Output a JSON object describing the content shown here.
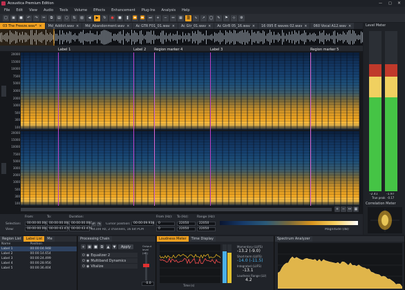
{
  "app": {
    "title": "Acoustica Premium Edition"
  },
  "menu": [
    "File",
    "Edit",
    "View",
    "Audio",
    "Tools",
    "Volume",
    "Effects",
    "Enhancement",
    "Plug-Ins",
    "Analysis",
    "Help"
  ],
  "tabs": [
    {
      "label": "03 The Freeze.wav*",
      "active": true
    },
    {
      "label": "Md_Addict.wav",
      "active": false
    },
    {
      "label": "Md_Abandonment.wav",
      "active": false
    },
    {
      "label": "Ac GTR F01_01.wav",
      "active": false
    },
    {
      "label": "Ac Gtr_01.wav",
      "active": false
    },
    {
      "label": "Ac GtrB 05_16.wav",
      "active": false
    },
    {
      "label": "16 095 E waves 02.wav",
      "active": false
    },
    {
      "label": "060 Vocal A12.wav",
      "active": false
    }
  ],
  "markers": [
    {
      "label": "Label 1"
    },
    {
      "label": "Label 2"
    },
    {
      "label": "Region marker 4"
    },
    {
      "label": "Label 3"
    },
    {
      "label": "Region marker 5"
    }
  ],
  "freq_axis": [
    "20000",
    "15000",
    "10000",
    "7500",
    "5000",
    "3000",
    "2000",
    "1000",
    "500",
    "300",
    "100"
  ],
  "freq_axis_ch2": [
    "20000",
    "15000",
    "10000",
    "7500",
    "5000",
    "3000",
    "2000",
    "1000",
    "500",
    "300",
    "100"
  ],
  "selection": {
    "selection_label": "Selection:",
    "view_label": "View:",
    "from_label": "From:",
    "to_label": "To:",
    "duration_label": "Duration:",
    "sel_from": "00:00:00.000",
    "sel_to": "00:00:00.000",
    "sel_dur": "00:00:00.000",
    "view_from": "00:00:00.000",
    "view_to": "00:00:43.476",
    "view_dur": "00:00:43.476",
    "format": "44100 Hz, 2 channels, 16 bit PCM",
    "cursor_label": "Cursor position:",
    "cursor": "00:00:09.938",
    "fromhz_label": "From (Hz):",
    "tohz_label": "To (Hz):",
    "range_label": "Range (Hz):",
    "from_hz_1": "0",
    "to_hz_1": "22050",
    "range_hz_1": "22050",
    "from_hz_2": "0",
    "to_hz_2": "22050",
    "range_hz_2": "22050",
    "magnitude_label": "Magnitude (dB)"
  },
  "level_meter": {
    "title": "Level Meter",
    "left": "-2.41",
    "right": "-1.97",
    "true_peak_label": "True peak",
    "true_peak": "-0.17"
  },
  "correlation": {
    "title": "Correlation Meter"
  },
  "label_list": {
    "tabs": [
      "Region List",
      "Label List",
      "Me"
    ],
    "headers": [
      "Name",
      "Position"
    ],
    "rows": [
      {
        "name": "Label 1",
        "pos": "00:00:04.948"
      },
      {
        "name": "Label 2",
        "pos": "00:00:14.654"
      },
      {
        "name": "Label 3",
        "pos": "00:00:24.499"
      },
      {
        "name": "Label 4",
        "pos": "00:00:28.956"
      },
      {
        "name": "Label 5",
        "pos": "00:00:36.404"
      }
    ]
  },
  "processing": {
    "title": "Processing Chain",
    "apply": "Apply",
    "output_label": "Output level (dB)",
    "output_value": "0.0",
    "items": [
      "Equalizer 2",
      "Multiband Dynamics",
      "Vitalize"
    ]
  },
  "loudness": {
    "tabs": [
      "Loudness Meter",
      "Time Display"
    ],
    "momentary_label": "Momentary (LUFS)",
    "momentary": "-13.2 (-9.0)",
    "shortterm_label": "Short-term (LUFS)",
    "shortterm": "-14.0 (-11.5)",
    "integrated_label": "Integrated (LUFS)",
    "integrated": "-13.1",
    "range_label": "Loudness Range (LU)",
    "range": "4.2",
    "xaxis_label": "Time (s)"
  },
  "spectrum": {
    "title": "Spectrum Analyzer"
  }
}
